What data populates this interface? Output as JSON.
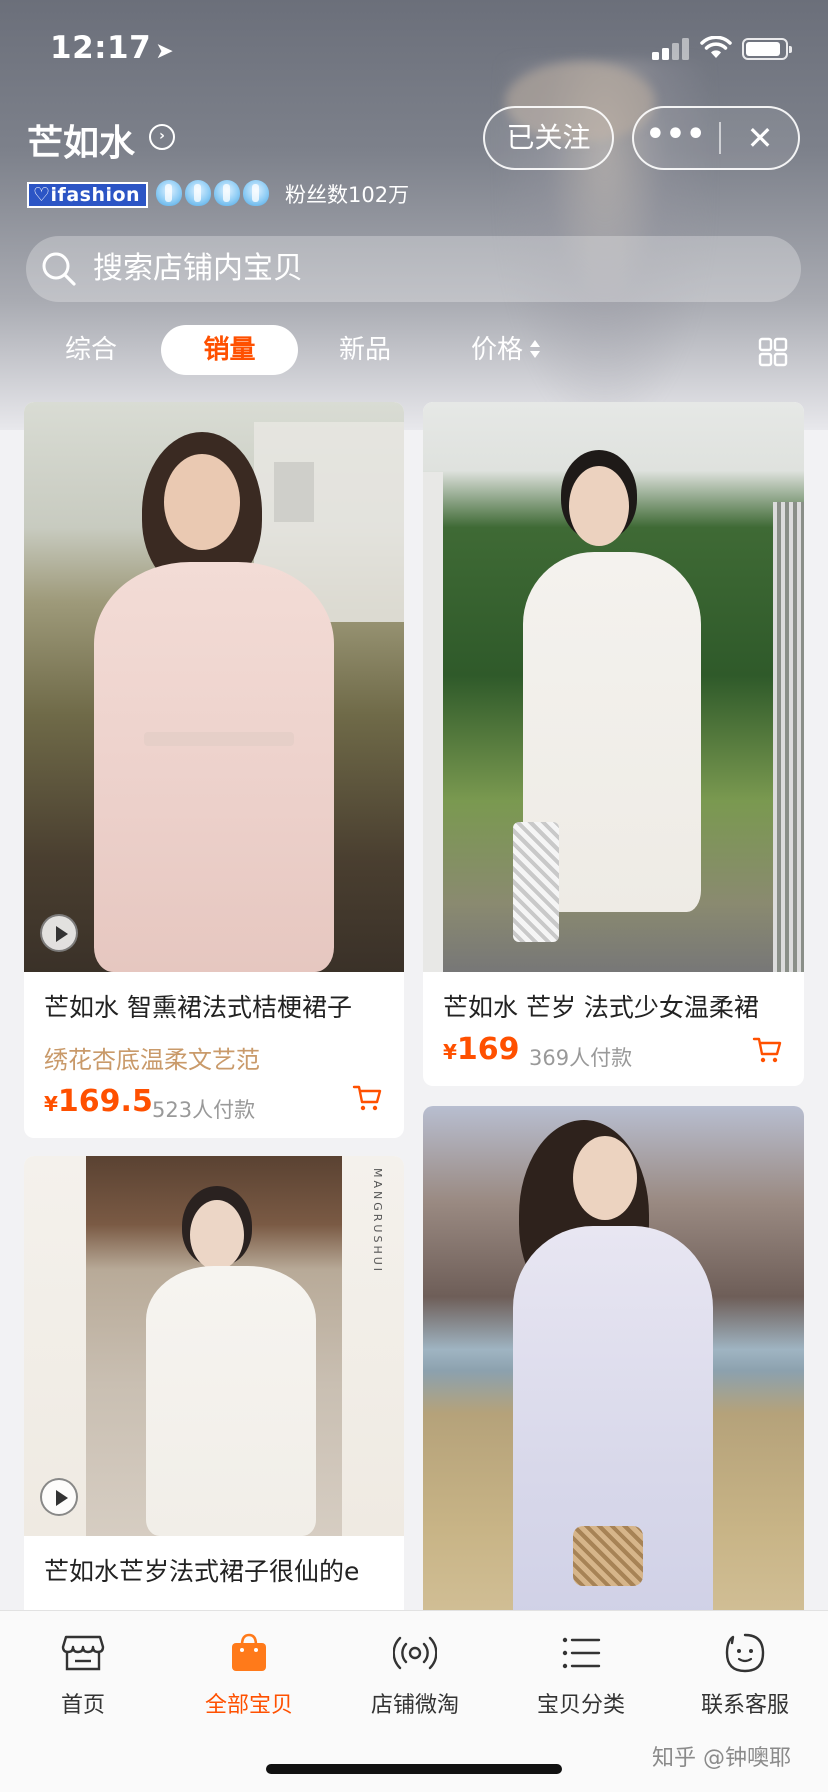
{
  "status_bar": {
    "time": "12:17",
    "location_arrow": "➤"
  },
  "shop": {
    "name": "芒如水",
    "follow_label": "已关注",
    "more_label": "•••",
    "close_label": "✕",
    "badge": "ifashion",
    "fans": "粉丝数102万"
  },
  "search": {
    "placeholder": "搜索店铺内宝贝"
  },
  "sort_tabs": [
    {
      "label": "综合",
      "active": false
    },
    {
      "label": "销量",
      "active": true
    },
    {
      "label": "新品",
      "active": false
    },
    {
      "label": "价格",
      "active": false
    }
  ],
  "products": [
    {
      "title": "芒如水 智熏裙法式桔梗裙子",
      "subtitle": "绣花杏底温柔文艺范",
      "currency": "¥",
      "price": "169.5",
      "sales": "523人付款",
      "has_video": true
    },
    {
      "title": "芒如水 芒岁 法式少女温柔裙",
      "subtitle": "",
      "currency": "¥",
      "price": "169",
      "sales": "369人付款",
      "has_video": false
    },
    {
      "title": "芒如水芒岁法式裙子很仙的e",
      "subtitle": "",
      "currency": "",
      "price": "",
      "sales": "",
      "has_video": true,
      "image_text": "MANGRUSHUI"
    },
    {
      "title": "",
      "subtitle": "",
      "currency": "",
      "price": "",
      "sales": "",
      "has_video": false
    }
  ],
  "tabbar": [
    {
      "label": "首页",
      "icon": "storefront-icon",
      "active": false
    },
    {
      "label": "全部宝贝",
      "icon": "shopping-bag-icon",
      "active": true
    },
    {
      "label": "店铺微淘",
      "icon": "broadcast-icon",
      "active": false
    },
    {
      "label": "宝贝分类",
      "icon": "list-icon",
      "active": false
    },
    {
      "label": "联系客服",
      "icon": "chat-bubble-icon",
      "active": false
    }
  ],
  "watermark": "知乎 @钟噢耶",
  "colors": {
    "accent": "#ff5000",
    "subtitle": "#c99a6a",
    "badge_blue": "#2c55c5"
  }
}
